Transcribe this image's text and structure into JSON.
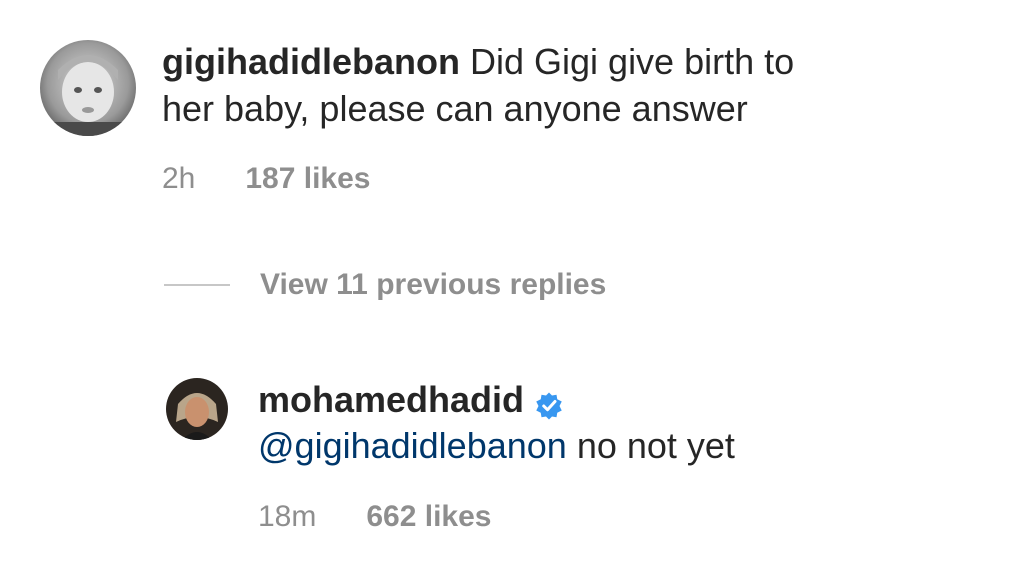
{
  "comment": {
    "username": "gigihadidlebanon",
    "line1": "Did Gigi give birth to",
    "line2": "her baby, please can anyone answer",
    "time": "2h",
    "likes": "187 likes"
  },
  "replies_toggle": {
    "label": "View 11 previous replies"
  },
  "reply": {
    "username": "mohamedhadid",
    "verified": true,
    "mention": "@gigihadidlebanon",
    "text": "no not yet",
    "time": "18m",
    "likes": "662 likes"
  },
  "colors": {
    "text": "#262626",
    "secondary": "#8e8e8e",
    "mention": "#00376b",
    "verified_badge": "#3897f0"
  },
  "icons": {
    "verified": "verified-badge-icon"
  }
}
